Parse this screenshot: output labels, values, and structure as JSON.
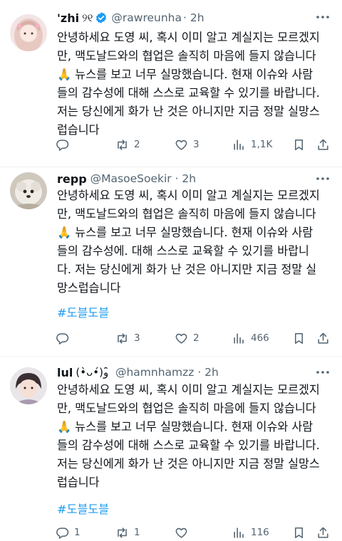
{
  "tweets": [
    {
      "name": "'zhi",
      "name_symbol": "୨୧",
      "verified": true,
      "handle": "@rawreunha",
      "time": "· 2h",
      "lines": [
        "안녕하세요 도영 씨, 혹시 이미 알고 계실지는 모르겠지",
        "만, 맥도날드와의 협업은 솔직히 마음에 들지 않습니다",
        "🙏 뉴스를 보고 너무 실망했습니다. 현재 이슈와 사람",
        "들의 감수성에 대해 스스로 교육할 수 있기를 바랍니다.",
        "저는 당신에게 화가 난 것은 아니지만 지금 정말 실망스",
        "럽습니다"
      ],
      "hashtag": "",
      "replies": "",
      "retweets": "2",
      "likes": "3",
      "views": "1,1K"
    },
    {
      "name": "repp",
      "name_symbol": "",
      "verified": false,
      "handle": "@MasoeSoekir · 2h",
      "time": "",
      "lines": [
        "안녕하세요 도영 씨, 혹시 이미 알고 계실지는 모르겠지",
        "만, 맥도날드와의 협업은 솔직히 마음에 들지 않습니다",
        "🙏 뉴스를 보고 너무 실망했습니다. 현재 이슈와 사람",
        "들의 감수성에. 대해 스스로 교육할 수 있기를 바랍니",
        "다. 저는 당신에게 화가 난 것은 아니지만 지금 정말 실",
        "망스럽습니다"
      ],
      "hashtag": "#도블도블",
      "replies": "",
      "retweets": "3",
      "likes": "2",
      "views": "466"
    },
    {
      "name": "lul",
      "name_symbol": "(•̀ᴗ•́)و ̑̑",
      "verified": false,
      "handle": "@hamnhamzz · 2h",
      "time": "",
      "lines": [
        "안녕하세요 도영 씨, 혹시 이미 알고 계실지는 모르겠지",
        "만, 맥도날드와의 협업은 솔직히 마음에 들지 않습니다",
        "🙏 뉴스를 보고 너무 실망했습니다. 현재 이슈와 사람",
        "들의 감수성에 대해 스스로 교육할 수 있기를 바랍니다.",
        "저는 당신에게 화가 난 것은 아니지만 지금 정말 실망스",
        "럽습니다"
      ],
      "hashtag": "#도블도블",
      "replies": "1",
      "retweets": "1",
      "likes": "",
      "views": "116"
    }
  ],
  "icons": {
    "reply": "reply-icon",
    "retweet": "retweet-icon",
    "like": "heart-icon",
    "views": "views-icon",
    "share": "share-icon",
    "more": "more-icon",
    "verified": "verified-badge-icon"
  },
  "colors": {
    "text": "#0f1419",
    "secondary": "#536471",
    "link": "#1d9bf0",
    "verified": "#1d9bf0",
    "divider": "#eff3f4"
  }
}
